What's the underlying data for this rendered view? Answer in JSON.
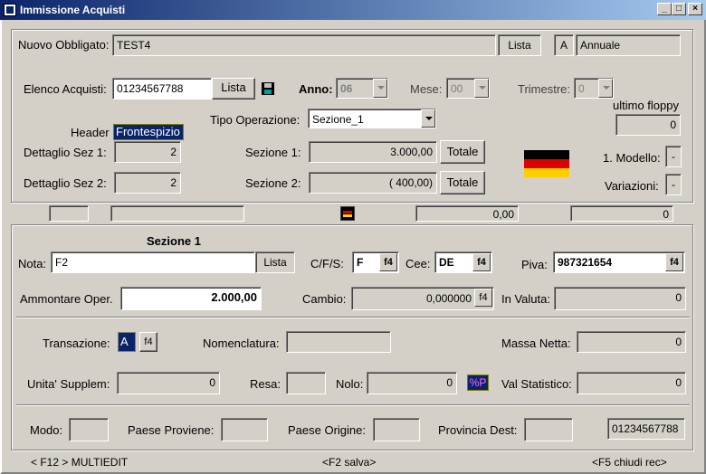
{
  "window": {
    "title": "Immissione Acquisti"
  },
  "top": {
    "nuovo_obbligato_label": "Nuovo Obbligato:",
    "nuovo_obbligato_value": "TEST4",
    "lista_label": "Lista",
    "periodicity_code": "A",
    "periodicity_text": "Annuale",
    "elenco_acquisti_label": "Elenco Acquisti:",
    "elenco_acquisti_value": "01234567788",
    "elenco_lista_label": "Lista",
    "anno_label": "Anno:",
    "anno_value": "06",
    "mese_label": "Mese:",
    "mese_value": "00",
    "trimestre_label": "Trimestre:",
    "trimestre_value": "0",
    "ultimo_floppy_label": "ultimo floppy",
    "ultimo_floppy_value": "0",
    "header_label": "Header",
    "frontespizio_label": "Frontespizio",
    "tipo_operazione_label": "Tipo Operazione:",
    "tipo_operazione_value": "Sezione_1",
    "dettaglio_sez1_label": "Dettaglio Sez 1:",
    "dettaglio_sez1_value": "2",
    "dettaglio_sez2_label": "Dettaglio Sez 2:",
    "dettaglio_sez2_value": "2",
    "sezione1_label": "Sezione 1:",
    "sezione1_value": "3.000,00",
    "sezione2_label": "Sezione 2:",
    "sezione2_value": "( 400,00)",
    "totale_label": "Totale",
    "modello_label": "1. Modello:",
    "modello_value": "-",
    "variazioni_label": "Variazioni:",
    "variazioni_value": "-"
  },
  "midbar": {
    "field1": "",
    "field2": "",
    "total_value": "0,00",
    "count_value": "0"
  },
  "section": {
    "title": "Sezione 1",
    "nota_label": "Nota:",
    "nota_value": "F2",
    "nota_lista_label": "Lista",
    "cfs_label": "C/F/S:",
    "cfs_value": "F",
    "cee_label": "Cee:",
    "cee_value": "DE",
    "f4_label": "f4",
    "piva_label": "Piva:",
    "piva_value": "987321654",
    "ammontare_label": "Ammontare Oper.",
    "ammontare_value": "2.000,00",
    "cambio_label": "Cambio:",
    "cambio_value": "0,000000",
    "in_valuta_label": "In Valuta:",
    "in_valuta_value": "0",
    "transazione_label": "Transazione:",
    "transazione_value": "A",
    "nomenclatura_label": "Nomenclatura:",
    "nomenclatura_value": "",
    "massa_netta_label": "Massa Netta:",
    "massa_netta_value": "0",
    "unita_label": "Unita' Supplem:",
    "unita_value": "0",
    "resa_label": "Resa:",
    "resa_value": "",
    "nolo_label": "Nolo:",
    "nolo_value": "0",
    "percent_label": "%P",
    "val_statistico_label": "Val Statistico:",
    "val_statistico_value": "0",
    "modo_label": "Modo:",
    "paese_proviene_label": "Paese Proviene:",
    "paese_origine_label": "Paese Origine:",
    "provincia_dest_label": "Provincia Dest:",
    "code_value": "01234567788"
  },
  "statusbar": {
    "left": "< F12 > MULTIEDIT",
    "center": "<F2 salva>",
    "right": "<F5 chiudi rec>"
  },
  "colors": {
    "title_gradient_start": "#0a246a",
    "title_gradient_end": "#a6caf0",
    "flag_black": "#000000",
    "flag_red": "#dd0000",
    "flag_gold": "#ffce00",
    "frontespizio_bg": "#0a246a",
    "percent_bg": "#0a246a"
  }
}
